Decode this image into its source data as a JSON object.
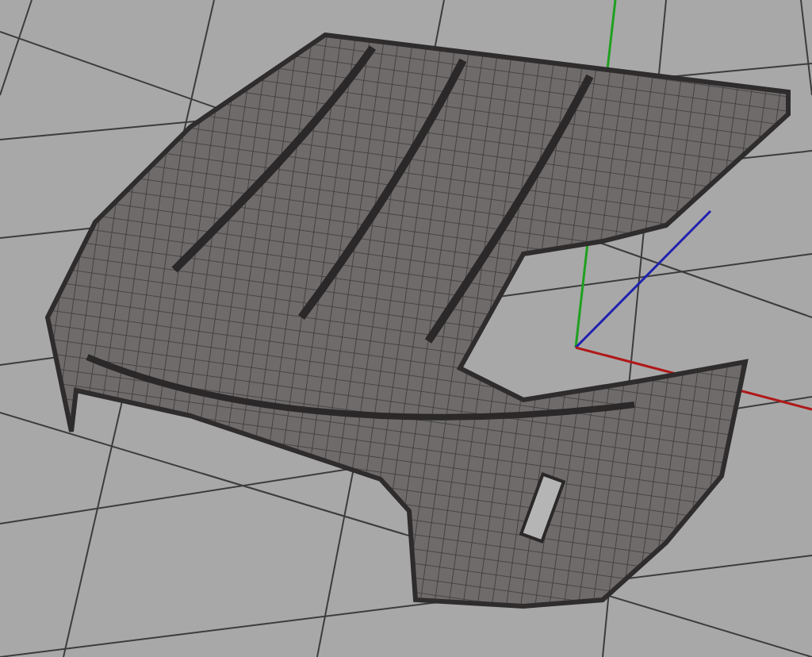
{
  "viewport": {
    "axes": [
      {
        "kind": "y",
        "color": "#1fa01f"
      },
      {
        "kind": "z",
        "color": "#2020b0"
      },
      {
        "kind": "x",
        "color": "#b01818"
      }
    ]
  }
}
